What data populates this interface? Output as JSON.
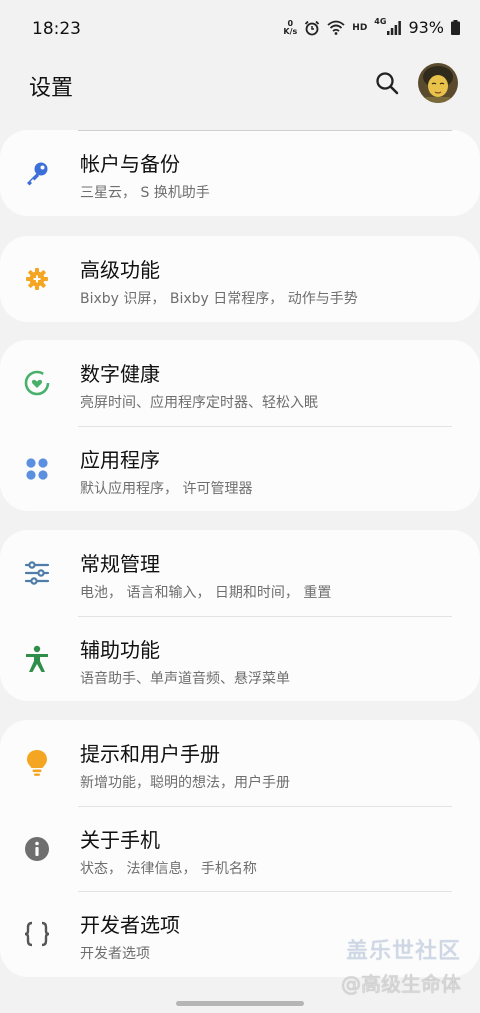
{
  "status_bar": {
    "time": "18:23",
    "net_speed_top": "0",
    "net_speed_unit": "K/s",
    "hd": "HD",
    "network_type": "4G",
    "battery": "93%"
  },
  "header": {
    "title": "设置"
  },
  "sections": [
    {
      "items": [
        {
          "title": "帐户与备份",
          "subtitle": "三星云， S 换机助手",
          "icon": "key-icon",
          "color": "#3d6fd8"
        }
      ]
    },
    {
      "items": [
        {
          "title": "高级功能",
          "subtitle": "Bixby 识屏， Bixby 日常程序， 动作与手势",
          "icon": "gear-plus-icon",
          "color": "#f4a623"
        }
      ]
    },
    {
      "items": [
        {
          "title": "数字健康",
          "subtitle": "亮屏时间、应用程序定时器、轻松入眠",
          "icon": "digital-wellbeing-icon",
          "color": "#49b06a"
        },
        {
          "title": "应用程序",
          "subtitle": "默认应用程序， 许可管理器",
          "icon": "apps-grid-icon",
          "color": "#5b8fe0"
        }
      ]
    },
    {
      "items": [
        {
          "title": "常规管理",
          "subtitle": "电池， 语言和输入， 日期和时间， 重置",
          "icon": "sliders-icon",
          "color": "#4f7ca8"
        },
        {
          "title": "辅助功能",
          "subtitle": "语音助手、单声道音频、悬浮菜单",
          "icon": "accessibility-icon",
          "color": "#2f8f4a"
        }
      ]
    },
    {
      "items": [
        {
          "title": "提示和用户手册",
          "subtitle": "新增功能，聪明的想法，用户手册",
          "icon": "lightbulb-icon",
          "color": "#f4a623"
        },
        {
          "title": "关于手机",
          "subtitle": "状态， 法律信息， 手机名称",
          "icon": "info-icon",
          "color": "#6f6f6f"
        },
        {
          "title": "开发者选项",
          "subtitle": "开发者选项",
          "icon": "braces-icon",
          "color": "#555555"
        }
      ]
    }
  ],
  "watermark": {
    "line1": "盖乐世社区",
    "line2": "@高级生命体"
  }
}
